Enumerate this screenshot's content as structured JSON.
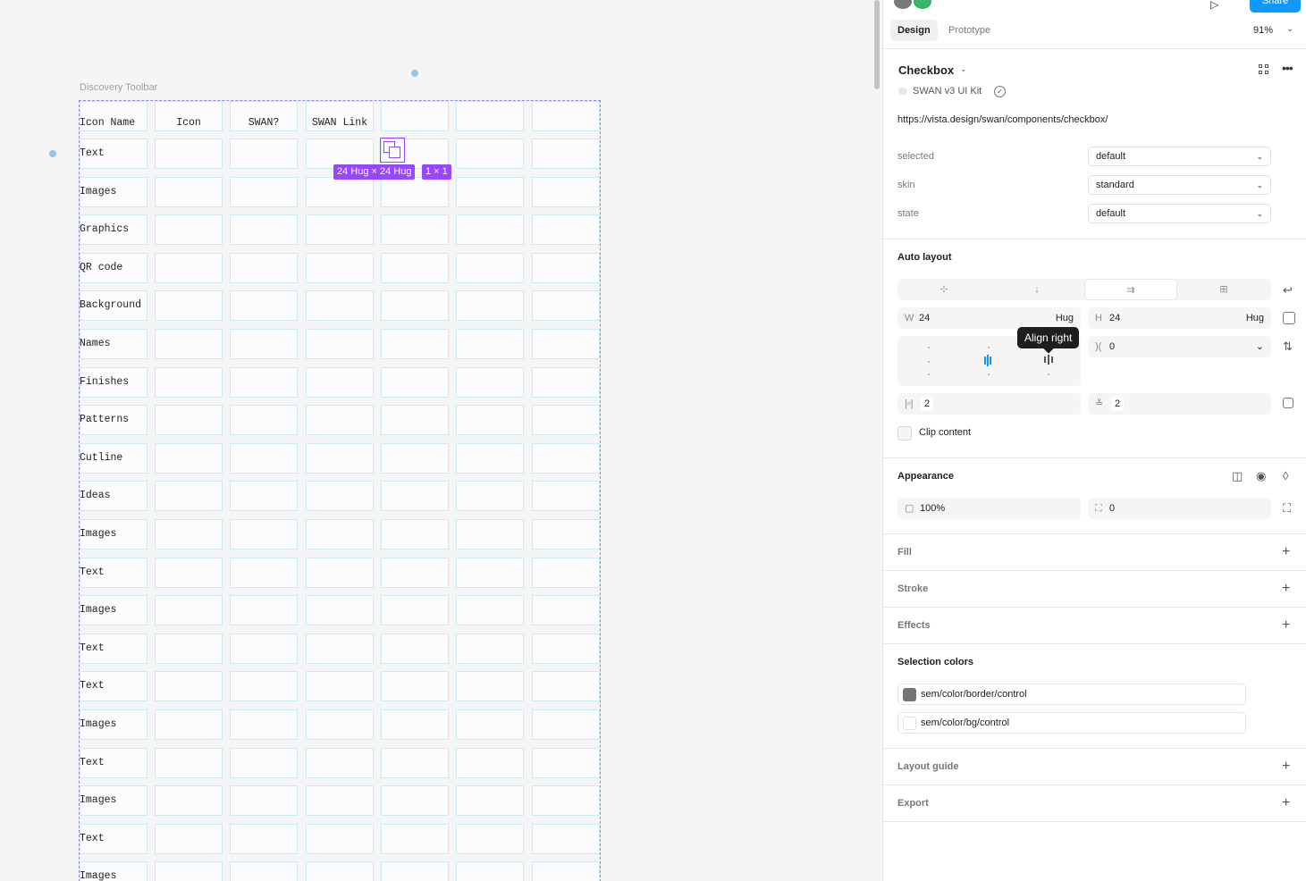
{
  "canvas": {
    "frame_name": "Discovery Toolbar",
    "headers": [
      "Icon Name",
      "Icon",
      "SWAN?",
      "SWAN Link"
    ],
    "rows": [
      "Text",
      "Images",
      "Graphics",
      "QR code",
      "Background",
      "Names",
      "Finishes",
      "Patterns",
      "Cutline",
      "Ideas",
      "Images",
      "Text",
      "Images",
      "Text",
      "Text",
      "Images",
      "Text",
      "Images",
      "Text",
      "Images"
    ],
    "size_badge": "24 Hug × 24 Hug",
    "grid_badge": "1 × 1"
  },
  "panel": {
    "header": {
      "share_label": "Share",
      "play_icon": "play-icon",
      "avatar_colors": [
        "#7a7a7a",
        "#3bb36b"
      ]
    },
    "tabs": {
      "design": "Design",
      "prototype": "Prototype"
    },
    "zoom": "91%",
    "component": {
      "name": "Checkbox",
      "library": "SWAN v3 UI Kit",
      "link": "https://vista.design/swan/components/checkbox/"
    },
    "props": [
      {
        "label": "selected",
        "value": "default"
      },
      {
        "label": "skin",
        "value": "standard"
      },
      {
        "label": "state",
        "value": "default"
      }
    ],
    "auto_layout": {
      "title": "Auto layout",
      "w_label": "W",
      "w_value": "24",
      "w_mode": "Hug",
      "h_label": "H",
      "h_value": "24",
      "h_mode": "Hug",
      "gap_value": "0",
      "pad_h": "2",
      "pad_v": "2",
      "tooltip": "Align right",
      "clip_label": "Clip content"
    },
    "appearance": {
      "title": "Appearance",
      "opacity": "100%",
      "radius": "0"
    },
    "sections": {
      "fill": "Fill",
      "stroke": "Stroke",
      "effects": "Effects"
    },
    "selection_colors": {
      "title": "Selection colors",
      "items": [
        {
          "name": "sem/color/border/control",
          "color": "#757575"
        },
        {
          "name": "sem/color/bg/control",
          "color": "#ffffff"
        }
      ]
    },
    "bottom_sections": {
      "layout_guide": "Layout guide",
      "export": "Export"
    }
  },
  "colors": {
    "accent": "#0d99ff",
    "selection": "#9747ff",
    "grid_border": "#cce9f4"
  }
}
